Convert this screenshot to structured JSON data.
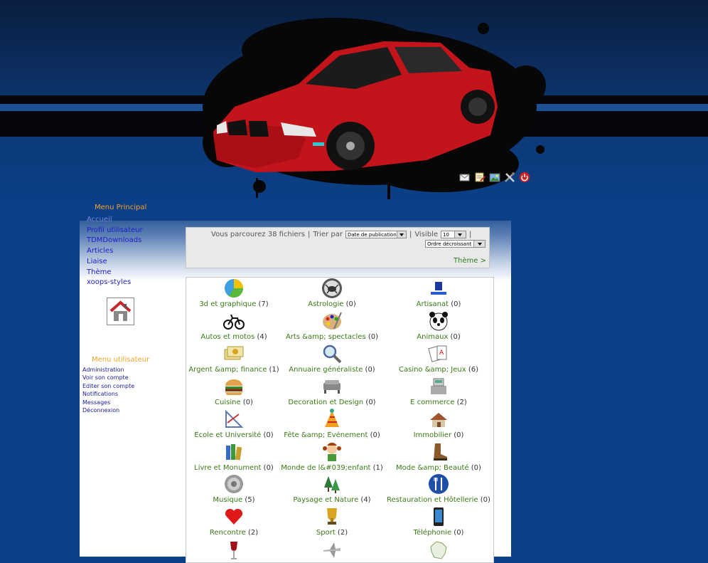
{
  "colors": {
    "background": "#0b3f86",
    "menu_title": "#f2a32c",
    "menu_link": "#1e1ec8",
    "category_link": "#3b7a17",
    "car": "#c4141b"
  },
  "header": {
    "toolbar": [
      {
        "icon": "envelope-icon"
      },
      {
        "icon": "edit-note-icon"
      },
      {
        "icon": "picture-icon"
      },
      {
        "icon": "tools-icon"
      },
      {
        "icon": "power-icon"
      }
    ]
  },
  "main_menu": {
    "title": "Menu Principal",
    "items": [
      "Accueil",
      "Profil utilisateur",
      "TDMDownloads",
      "Articles",
      "Liaise",
      "Thème",
      "xoops-styles"
    ]
  },
  "user_menu": {
    "title": "Menu utilisateur",
    "items": [
      "Administration",
      "Voir son compte",
      "Editer son compte",
      "Notifications",
      "Messages",
      "Déconnexion"
    ]
  },
  "browse": {
    "text": "Vous parcourez 38 fichiers",
    "sort_label": "Trier par",
    "sort_value": "Date de publication",
    "visible_label": "Visible",
    "visible_value": "10",
    "order_value": "Ordre décroissant",
    "theme_link": "Thème >"
  },
  "categories": [
    {
      "name": "3d et graphique",
      "count": "(7)",
      "icon": "pie-chart-icon"
    },
    {
      "name": "Astrologie",
      "count": "(0)",
      "icon": "cancer-crab-icon"
    },
    {
      "name": "Artisanat",
      "count": "(0)",
      "icon": "artisan-logo-icon"
    },
    {
      "name": "Autos et motos",
      "count": "(4)",
      "icon": "motorbike-icon"
    },
    {
      "name": "Arts &amp; spectacles",
      "count": "(0)",
      "icon": "paint-palette-icon"
    },
    {
      "name": "Animaux",
      "count": "(0)",
      "icon": "panda-icon"
    },
    {
      "name": "Argent &amp; finance",
      "count": "(1)",
      "icon": "money-icon"
    },
    {
      "name": "Annuaire généraliste",
      "count": "(0)",
      "icon": "magnifier-icon"
    },
    {
      "name": "Casino &amp; Jeux",
      "count": "(6)",
      "icon": "playing-cards-icon"
    },
    {
      "name": "Cuisine",
      "count": "(0)",
      "icon": "burger-icon"
    },
    {
      "name": "Decoration et Design",
      "count": "(0)",
      "icon": "sofa-icon"
    },
    {
      "name": "E commerce",
      "count": "(2)",
      "icon": "cash-register-icon"
    },
    {
      "name": "Ecole et Université",
      "count": "(0)",
      "icon": "drawing-tools-icon"
    },
    {
      "name": "Fête &amp; Evénement",
      "count": "(0)",
      "icon": "party-hat-icon"
    },
    {
      "name": "Immobilier",
      "count": "(0)",
      "icon": "house-icon"
    },
    {
      "name": "Livre et Monument",
      "count": "(0)",
      "icon": "books-icon"
    },
    {
      "name": "Monde de l&#039;enfant",
      "count": "(1)",
      "icon": "child-doll-icon"
    },
    {
      "name": "Mode &amp; Beauté",
      "count": "(0)",
      "icon": "boot-icon"
    },
    {
      "name": "Musique",
      "count": "(5)",
      "icon": "speaker-icon"
    },
    {
      "name": "Paysage et Nature",
      "count": "(4)",
      "icon": "pine-trees-icon"
    },
    {
      "name": "Restauration et Hôtellerie",
      "count": "(0)",
      "icon": "fork-knife-icon"
    },
    {
      "name": "Rencontre",
      "count": "(2)",
      "icon": "heart-icon"
    },
    {
      "name": "Sport",
      "count": "(2)",
      "icon": "trophy-icon"
    },
    {
      "name": "Téléphonie",
      "count": "(0)",
      "icon": "smartphone-icon"
    },
    {
      "name": "",
      "count": "",
      "icon": "wine-glass-icon"
    },
    {
      "name": "",
      "count": "",
      "icon": "airplane-icon"
    },
    {
      "name": "",
      "count": "",
      "icon": "france-map-icon"
    }
  ]
}
